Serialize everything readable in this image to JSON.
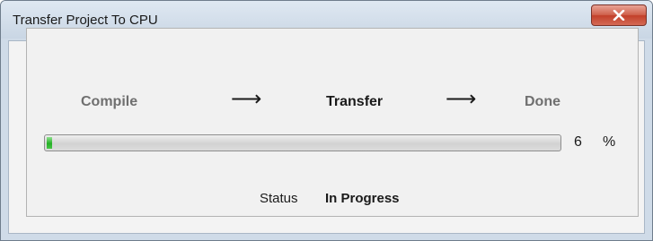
{
  "window": {
    "title": "Transfer Project To CPU",
    "close_icon": "close-x-icon"
  },
  "steps": {
    "compile": "Compile",
    "transfer": "Transfer",
    "done": "Done",
    "arrow": "⟶",
    "active": "transfer"
  },
  "progress": {
    "value": "6",
    "unit": "%",
    "fraction": 0.06,
    "fill_color": "#2bb52b"
  },
  "status": {
    "label": "Status",
    "value": "In Progress"
  },
  "colors": {
    "close_button": "#c9452f",
    "titlebar": "#cfdbe8",
    "inactive_step": "#6f6f6f"
  }
}
